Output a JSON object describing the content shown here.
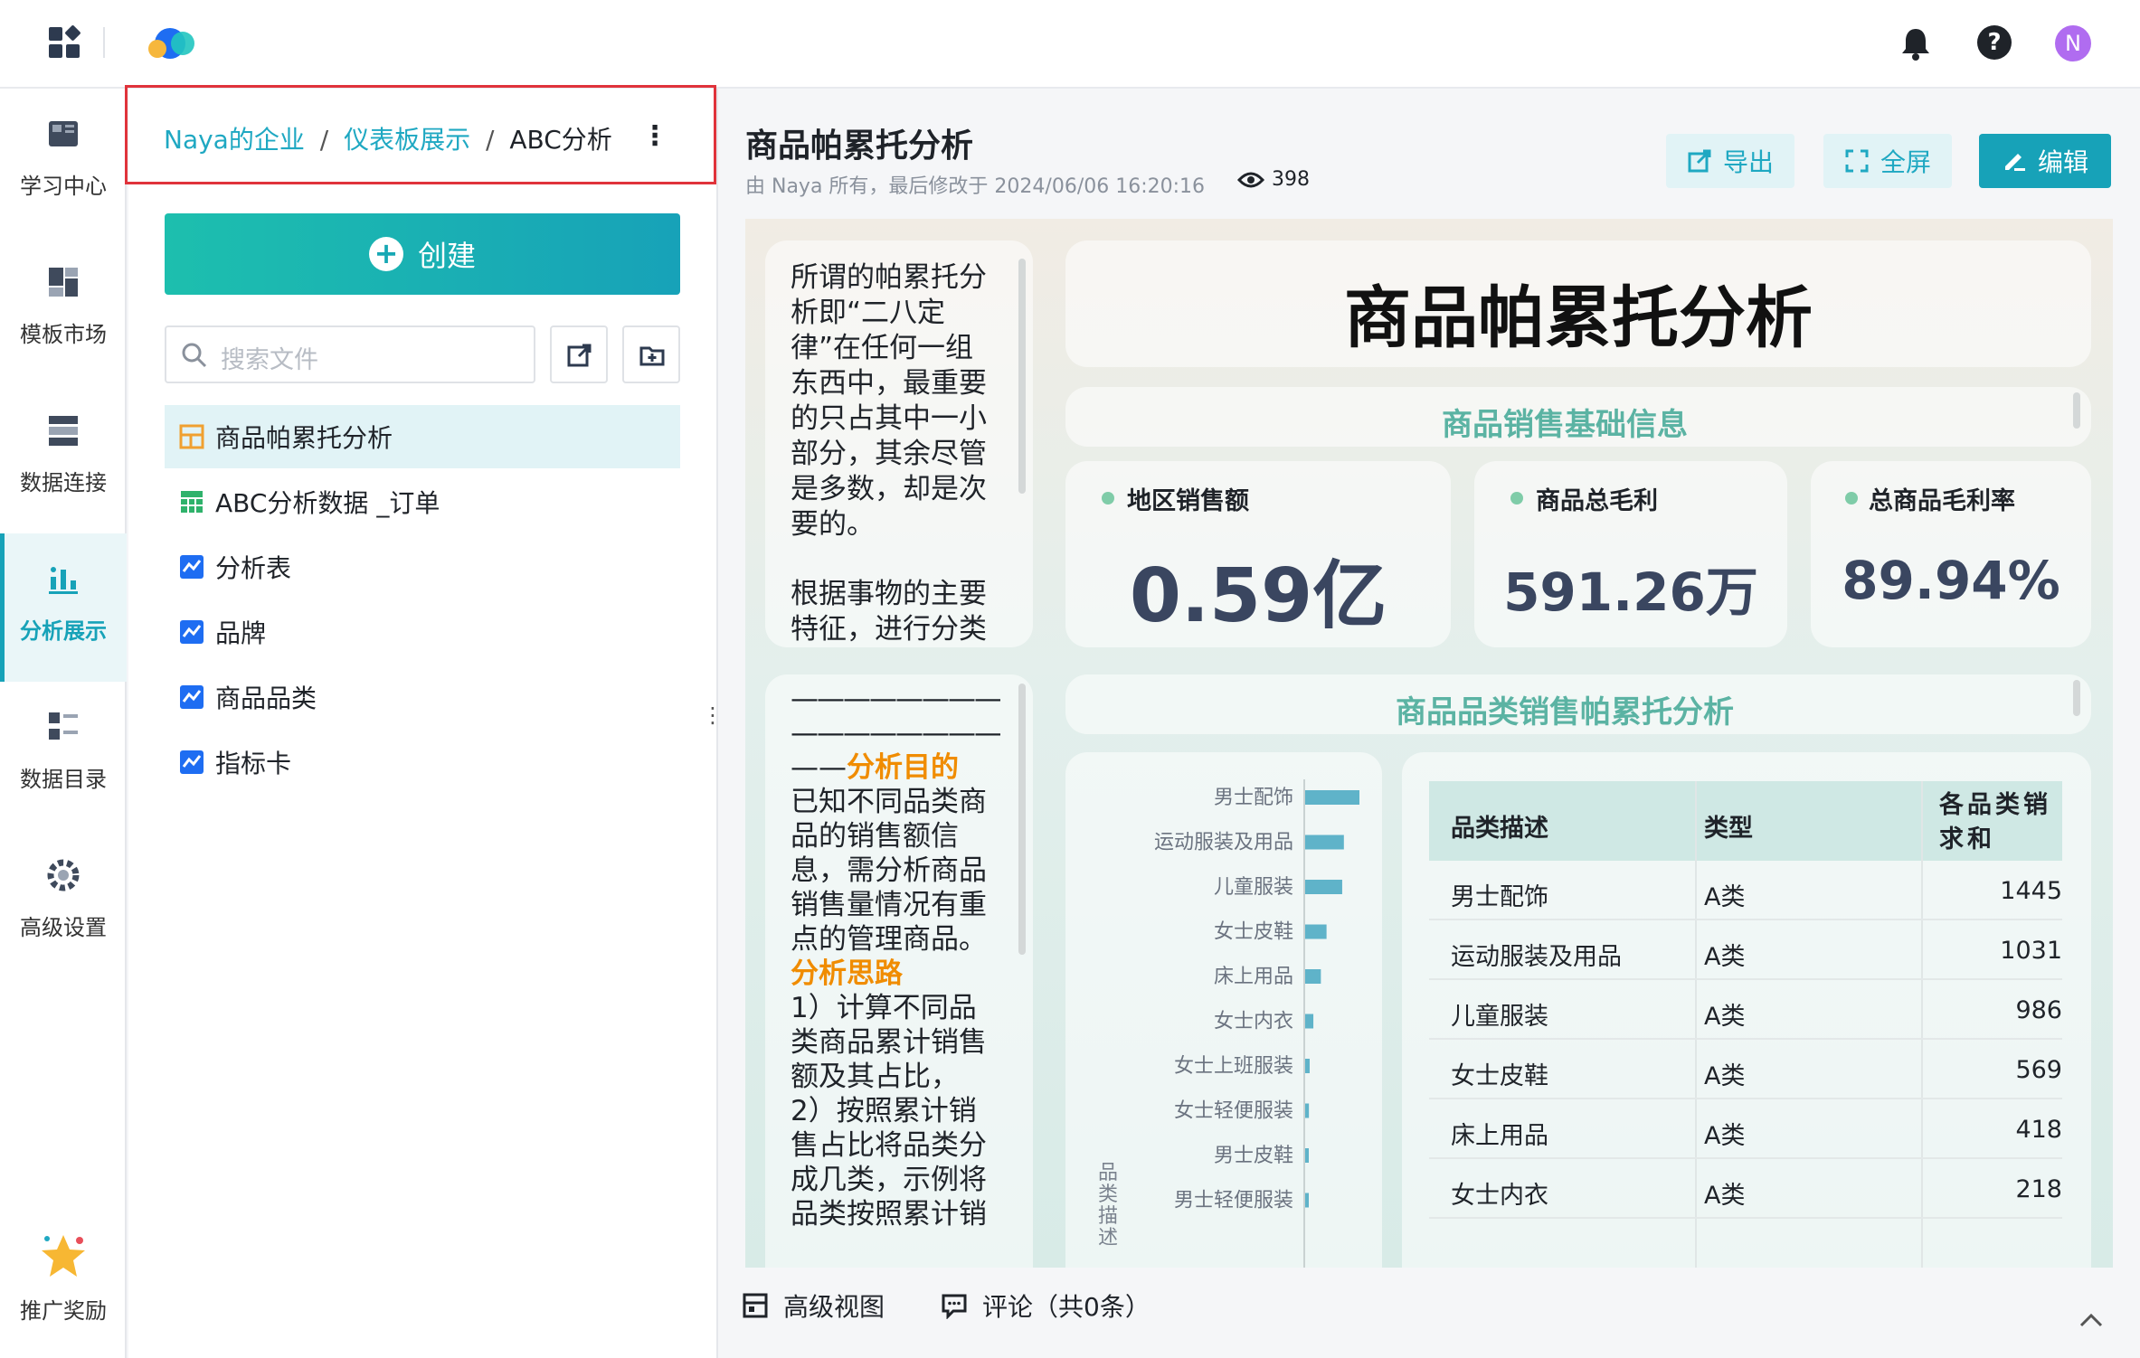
{
  "topbar": {
    "notification_icon": "bell-icon",
    "help_icon": "help-icon",
    "avatar_letter": "N",
    "avatar_color": "#b06cf0"
  },
  "sidebar": {
    "items": [
      {
        "label": "学习中心",
        "icon": "book-icon"
      },
      {
        "label": "模板市场",
        "icon": "template-icon"
      },
      {
        "label": "数据连接",
        "icon": "database-icon"
      },
      {
        "label": "分析展示",
        "icon": "chart-icon",
        "active": true
      },
      {
        "label": "数据目录",
        "icon": "catalog-icon"
      },
      {
        "label": "高级设置",
        "icon": "gear-icon"
      }
    ],
    "reward_label": "推广奖励"
  },
  "filepanel": {
    "breadcrumb": [
      "Naya的企业",
      "仪表板展示",
      "ABC分析"
    ],
    "breadcrumb_sep": "/",
    "create_label": "创建",
    "search_placeholder": "搜索文件",
    "files": [
      {
        "name": "商品帕累托分析",
        "icon": "dashboard-icon",
        "selected": true
      },
      {
        "name": "ABC分析数据 _订单",
        "icon": "table-icon"
      },
      {
        "name": "分析表",
        "icon": "analysis-icon"
      },
      {
        "name": "品牌",
        "icon": "analysis-icon"
      },
      {
        "name": "商品品类",
        "icon": "analysis-icon"
      },
      {
        "name": "指标卡",
        "icon": "analysis-icon"
      }
    ]
  },
  "main": {
    "title": "商品帕累托分析",
    "meta": "由 Naya 所有，最后修改于 2024/06/06 16:20:16",
    "views": "398",
    "export_label": "导出",
    "fullscreen_label": "全屏",
    "edit_label": "编辑",
    "accent_color": "#17a2b8"
  },
  "dashboard": {
    "intro_text_1": "所谓的帕累托分析即“二八定律”在任何一组东西中，最重要的只占其中一小部分，其余尽管是多数，却是次要的。",
    "intro_text_2": "根据事物的主要特征，进行分类",
    "big_title": "商品帕累托分析",
    "section1_title": "商品销售基础信息",
    "kpis": [
      {
        "label": "地区销售额",
        "value": "0.59亿"
      },
      {
        "label": "商品总毛利",
        "value": "591.26万"
      },
      {
        "label": "总商品毛利率",
        "value": "89.94%"
      }
    ],
    "dash_lines": "————————————————",
    "purpose_prefix": "——",
    "purpose_title": "分析目的",
    "purpose_text": "已知不同品类商品的销售额信息，需分析商品销售量情况有重点的管理商品。",
    "approach_title": "分析思路",
    "approach_text_1": "1）计算不同品类商品累计销售额及其占比，",
    "approach_text_2": "2）按照累计销售占比将品类分成几类，示例将品类按照累计销",
    "section2_title": "商品品类销售帕累托分析",
    "bar_axis_label": "品类描述",
    "table": {
      "headers": [
        "品类描述",
        "类型",
        "各品类销求和"
      ],
      "rows": [
        [
          "男士配饰",
          "A类",
          "1445"
        ],
        [
          "运动服装及用品",
          "A类",
          "1031"
        ],
        [
          "儿童服装",
          "A类",
          "986"
        ],
        [
          "女士皮鞋",
          "A类",
          "569"
        ],
        [
          "床上用品",
          "A类",
          "418"
        ],
        [
          "女士内衣",
          "A类",
          "218"
        ]
      ]
    }
  },
  "chart_data": {
    "type": "bar",
    "orientation": "horizontal",
    "categories": [
      "男士配饰",
      "运动服装及用品",
      "儿童服装",
      "女士皮鞋",
      "床上用品",
      "女士内衣",
      "女士上班服装",
      "女士轻便服装",
      "男士皮鞋",
      "男士轻便服装"
    ],
    "values": [
      1445,
      1031,
      986,
      569,
      418,
      218,
      120,
      100,
      90,
      70
    ],
    "ylabel": "品类描述",
    "bar_color": "#5fb3c9"
  },
  "footer": {
    "advanced_view_label": "高级视图",
    "comment_label": "评论（共0条）"
  }
}
